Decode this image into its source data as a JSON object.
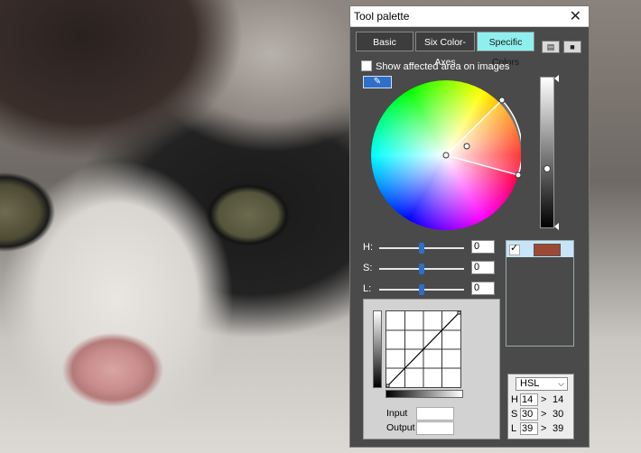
{
  "window": {
    "title": "Tool palette",
    "close_label": "✕"
  },
  "tabs": [
    {
      "label": "Basic",
      "active": false
    },
    {
      "label": "Six Color-Axes",
      "active": false
    },
    {
      "label": "Specific Colors",
      "active": true
    }
  ],
  "toolbar": {
    "open_icon": "folder-icon",
    "save_icon": "save-icon"
  },
  "show_affected": {
    "label": "Show affected area on images",
    "checked": false
  },
  "eyedropper_icon": "eyedropper-icon",
  "sliders": [
    {
      "label": "H:",
      "value": "0"
    },
    {
      "label": "S:",
      "value": "0"
    },
    {
      "label": "L:",
      "value": "0"
    }
  ],
  "color_list": [
    {
      "checked": true,
      "checkmark": "✓",
      "color": "#9e4935"
    }
  ],
  "curve": {
    "input_label": "Input",
    "output_label": "Output"
  },
  "hsl": {
    "mode": "HSL",
    "rows": [
      {
        "label": "H",
        "input": "14",
        "arrow": ">",
        "output": "14"
      },
      {
        "label": "S",
        "input": "30",
        "arrow": ">",
        "output": "30"
      },
      {
        "label": "L",
        "input": "39",
        "arrow": ">",
        "output": "39"
      }
    ]
  }
}
